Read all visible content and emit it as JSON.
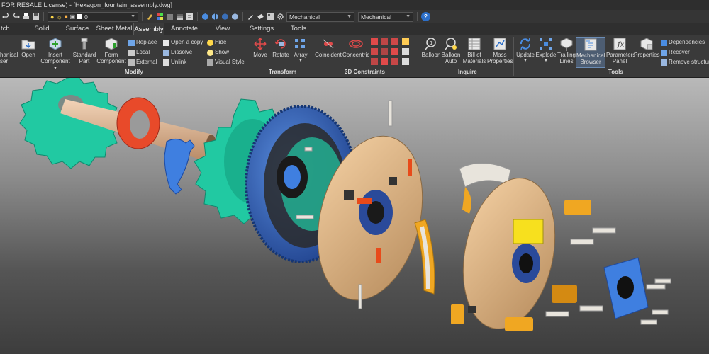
{
  "title": {
    "text": "FOR RESALE License) - [Hexagon_fountain_assembly.dwg]"
  },
  "quick_access": {
    "layer_value": "0",
    "workspace_value": "Mechanical",
    "visual_value": "Mechanical"
  },
  "tabs": [
    {
      "label": "tch"
    },
    {
      "label": "Solid"
    },
    {
      "label": "Surface"
    },
    {
      "label": "Sheet Metal"
    },
    {
      "label": "Assembly"
    },
    {
      "label": "Annotate"
    },
    {
      "label": "View"
    },
    {
      "label": "Settings"
    },
    {
      "label": "Tools"
    }
  ],
  "ribbon": {
    "modify": {
      "title": "Modify",
      "mechanical_label": "hanical\nser",
      "open_label": "Open",
      "insert_component_label": "Insert\nComponent",
      "standard_part_label": "Standard\nPart",
      "form_component_label": "Form\nComponent",
      "replace_label": "Replace",
      "local_label": "Local",
      "external_label": "External",
      "open_copy_label": "Open a copy",
      "dissolve_label": "Dissolve",
      "unlink_label": "Unlink",
      "hide_label": "Hide",
      "show_label": "Show",
      "visual_style_label": "Visual Style"
    },
    "transform": {
      "title": "Transform",
      "move_label": "Move",
      "rotate_label": "Rotate",
      "array_label": "Array"
    },
    "constraints": {
      "title": "3D Constraints",
      "coincident_label": "Coincident",
      "concentric_label": "Concentric"
    },
    "inquire": {
      "title": "Inquire",
      "balloon_label": "Balloon",
      "balloon_auto_label": "Balloon\nAuto",
      "bom_label": "Bill of\nMaterials",
      "mass_label": "Mass\nProperties"
    },
    "tools": {
      "title": "Tools",
      "update_label": "Update",
      "explode_label": "Explode",
      "trailing_label": "Trailing\nLines",
      "browser_label": "Mechanical\nBrowser",
      "params_label": "Parameters\nPanel",
      "properties_label": "Properties",
      "dependencies_label": "Dependencies",
      "recover_label": "Recover",
      "remove_structure_label": "Remove structure"
    }
  },
  "colors": {
    "accent_blue": "#2c6fc9",
    "sprocket_teal": "#21c9a2",
    "gear_blue": "#2a5fc4",
    "plate_tan": "#d9b48a",
    "pad_orange": "#f0a722",
    "bolt_white": "#e8e4dc",
    "spring_orange": "#e84a1a"
  }
}
